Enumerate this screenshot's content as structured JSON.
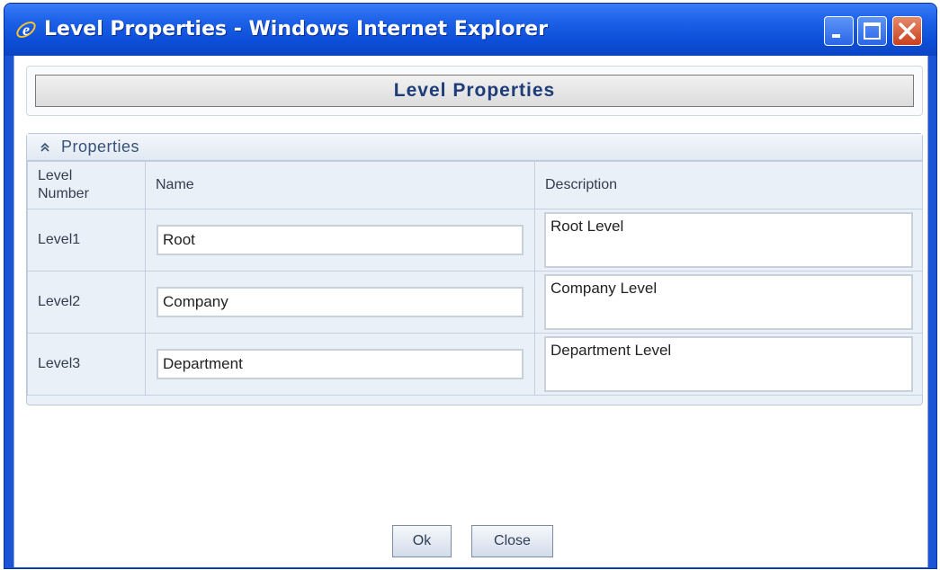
{
  "window": {
    "title": "Level Properties - Windows Internet Explorer",
    "icon": "ie-icon",
    "controls": [
      "minimize-icon",
      "maximize-icon",
      "close-icon"
    ]
  },
  "header": {
    "title": "Level Properties"
  },
  "properties": {
    "section_title": "Properties",
    "columns": [
      "Level\nNumber",
      "Name",
      "Description"
    ],
    "rows": [
      {
        "level": "Level1",
        "name": "Root",
        "description": "Root Level"
      },
      {
        "level": "Level2",
        "name": "Company",
        "description": "Company Level"
      },
      {
        "level": "Level3",
        "name": "Department",
        "description": "Department Level"
      }
    ]
  },
  "buttons": {
    "ok": "Ok",
    "close": "Close"
  },
  "colors": {
    "titlebar": "#0d4fd8",
    "panel_bg": "#e9f0f8",
    "header_text": "#1d3c78",
    "close_button": "#c9401f"
  }
}
